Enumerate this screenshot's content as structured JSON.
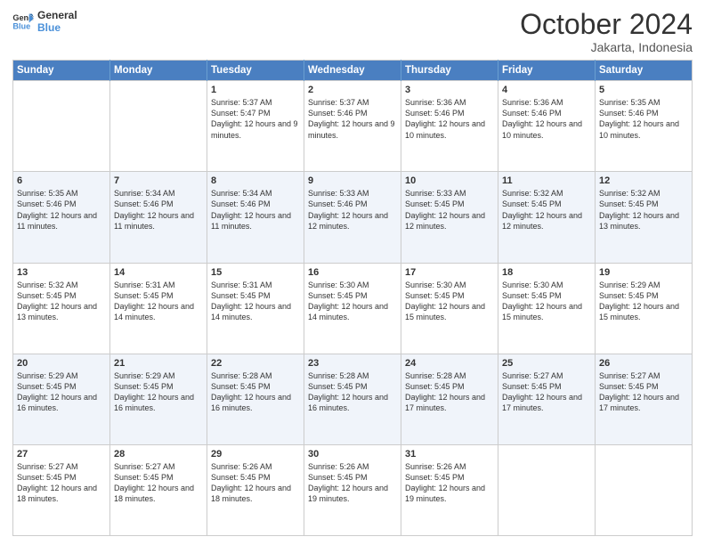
{
  "logo": {
    "line1": "General",
    "line2": "Blue"
  },
  "title": "October 2024",
  "subtitle": "Jakarta, Indonesia",
  "days_header": [
    "Sunday",
    "Monday",
    "Tuesday",
    "Wednesday",
    "Thursday",
    "Friday",
    "Saturday"
  ],
  "weeks": [
    [
      {
        "day": "",
        "info": ""
      },
      {
        "day": "",
        "info": ""
      },
      {
        "day": "1",
        "info": "Sunrise: 5:37 AM\nSunset: 5:47 PM\nDaylight: 12 hours and 9 minutes."
      },
      {
        "day": "2",
        "info": "Sunrise: 5:37 AM\nSunset: 5:46 PM\nDaylight: 12 hours and 9 minutes."
      },
      {
        "day": "3",
        "info": "Sunrise: 5:36 AM\nSunset: 5:46 PM\nDaylight: 12 hours and 10 minutes."
      },
      {
        "day": "4",
        "info": "Sunrise: 5:36 AM\nSunset: 5:46 PM\nDaylight: 12 hours and 10 minutes."
      },
      {
        "day": "5",
        "info": "Sunrise: 5:35 AM\nSunset: 5:46 PM\nDaylight: 12 hours and 10 minutes."
      }
    ],
    [
      {
        "day": "6",
        "info": "Sunrise: 5:35 AM\nSunset: 5:46 PM\nDaylight: 12 hours and 11 minutes."
      },
      {
        "day": "7",
        "info": "Sunrise: 5:34 AM\nSunset: 5:46 PM\nDaylight: 12 hours and 11 minutes."
      },
      {
        "day": "8",
        "info": "Sunrise: 5:34 AM\nSunset: 5:46 PM\nDaylight: 12 hours and 11 minutes."
      },
      {
        "day": "9",
        "info": "Sunrise: 5:33 AM\nSunset: 5:46 PM\nDaylight: 12 hours and 12 minutes."
      },
      {
        "day": "10",
        "info": "Sunrise: 5:33 AM\nSunset: 5:45 PM\nDaylight: 12 hours and 12 minutes."
      },
      {
        "day": "11",
        "info": "Sunrise: 5:32 AM\nSunset: 5:45 PM\nDaylight: 12 hours and 12 minutes."
      },
      {
        "day": "12",
        "info": "Sunrise: 5:32 AM\nSunset: 5:45 PM\nDaylight: 12 hours and 13 minutes."
      }
    ],
    [
      {
        "day": "13",
        "info": "Sunrise: 5:32 AM\nSunset: 5:45 PM\nDaylight: 12 hours and 13 minutes."
      },
      {
        "day": "14",
        "info": "Sunrise: 5:31 AM\nSunset: 5:45 PM\nDaylight: 12 hours and 14 minutes."
      },
      {
        "day": "15",
        "info": "Sunrise: 5:31 AM\nSunset: 5:45 PM\nDaylight: 12 hours and 14 minutes."
      },
      {
        "day": "16",
        "info": "Sunrise: 5:30 AM\nSunset: 5:45 PM\nDaylight: 12 hours and 14 minutes."
      },
      {
        "day": "17",
        "info": "Sunrise: 5:30 AM\nSunset: 5:45 PM\nDaylight: 12 hours and 15 minutes."
      },
      {
        "day": "18",
        "info": "Sunrise: 5:30 AM\nSunset: 5:45 PM\nDaylight: 12 hours and 15 minutes."
      },
      {
        "day": "19",
        "info": "Sunrise: 5:29 AM\nSunset: 5:45 PM\nDaylight: 12 hours and 15 minutes."
      }
    ],
    [
      {
        "day": "20",
        "info": "Sunrise: 5:29 AM\nSunset: 5:45 PM\nDaylight: 12 hours and 16 minutes."
      },
      {
        "day": "21",
        "info": "Sunrise: 5:29 AM\nSunset: 5:45 PM\nDaylight: 12 hours and 16 minutes."
      },
      {
        "day": "22",
        "info": "Sunrise: 5:28 AM\nSunset: 5:45 PM\nDaylight: 12 hours and 16 minutes."
      },
      {
        "day": "23",
        "info": "Sunrise: 5:28 AM\nSunset: 5:45 PM\nDaylight: 12 hours and 16 minutes."
      },
      {
        "day": "24",
        "info": "Sunrise: 5:28 AM\nSunset: 5:45 PM\nDaylight: 12 hours and 17 minutes."
      },
      {
        "day": "25",
        "info": "Sunrise: 5:27 AM\nSunset: 5:45 PM\nDaylight: 12 hours and 17 minutes."
      },
      {
        "day": "26",
        "info": "Sunrise: 5:27 AM\nSunset: 5:45 PM\nDaylight: 12 hours and 17 minutes."
      }
    ],
    [
      {
        "day": "27",
        "info": "Sunrise: 5:27 AM\nSunset: 5:45 PM\nDaylight: 12 hours and 18 minutes."
      },
      {
        "day": "28",
        "info": "Sunrise: 5:27 AM\nSunset: 5:45 PM\nDaylight: 12 hours and 18 minutes."
      },
      {
        "day": "29",
        "info": "Sunrise: 5:26 AM\nSunset: 5:45 PM\nDaylight: 12 hours and 18 minutes."
      },
      {
        "day": "30",
        "info": "Sunrise: 5:26 AM\nSunset: 5:45 PM\nDaylight: 12 hours and 19 minutes."
      },
      {
        "day": "31",
        "info": "Sunrise: 5:26 AM\nSunset: 5:45 PM\nDaylight: 12 hours and 19 minutes."
      },
      {
        "day": "",
        "info": ""
      },
      {
        "day": "",
        "info": ""
      }
    ]
  ]
}
